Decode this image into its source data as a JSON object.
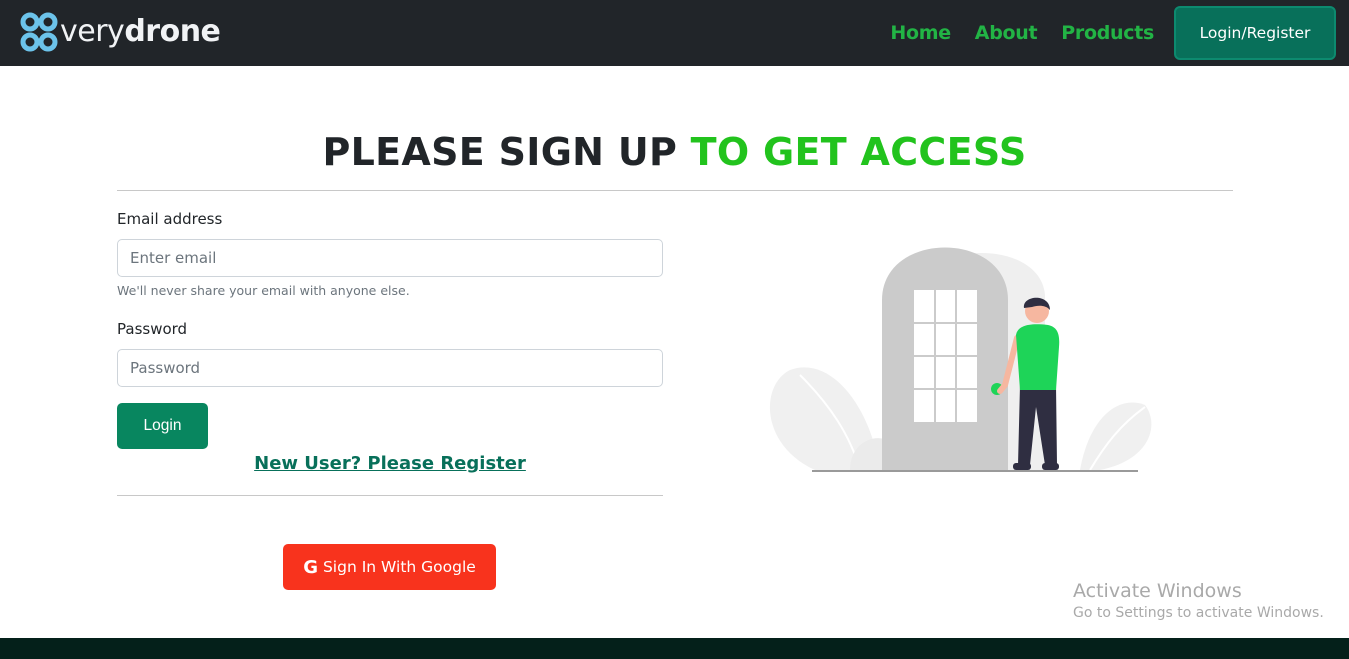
{
  "navbar": {
    "brand_prefix": "very",
    "brand_suffix": "drone",
    "links": [
      "Home",
      "About",
      "Products"
    ],
    "cta_label": "Login/Register",
    "colors": {
      "background": "#212529",
      "link": "#22b445",
      "cta": "#08705a"
    }
  },
  "heading": {
    "part1": "PLEASE SIGN UP",
    "part2": "TO GET ACCESS",
    "accent_color": "#22c31d"
  },
  "form": {
    "email_label": "Email address",
    "email_placeholder": "Enter email",
    "email_help": "We'll never share your email with anyone else.",
    "password_label": "Password",
    "password_placeholder": "Password",
    "login_label": "Login",
    "register_link": "New User? Please Register",
    "google_label": "Sign In With Google",
    "google_icon": "google-g-icon",
    "colors": {
      "login": "#08865f",
      "google": "#f8331d",
      "link": "#08705a"
    }
  },
  "illustration": {
    "icon": "person-at-door-illustration",
    "accent_color": "#1ed458"
  },
  "watermark": {
    "title": "Activate Windows",
    "subtitle": "Go to Settings to activate Windows."
  }
}
